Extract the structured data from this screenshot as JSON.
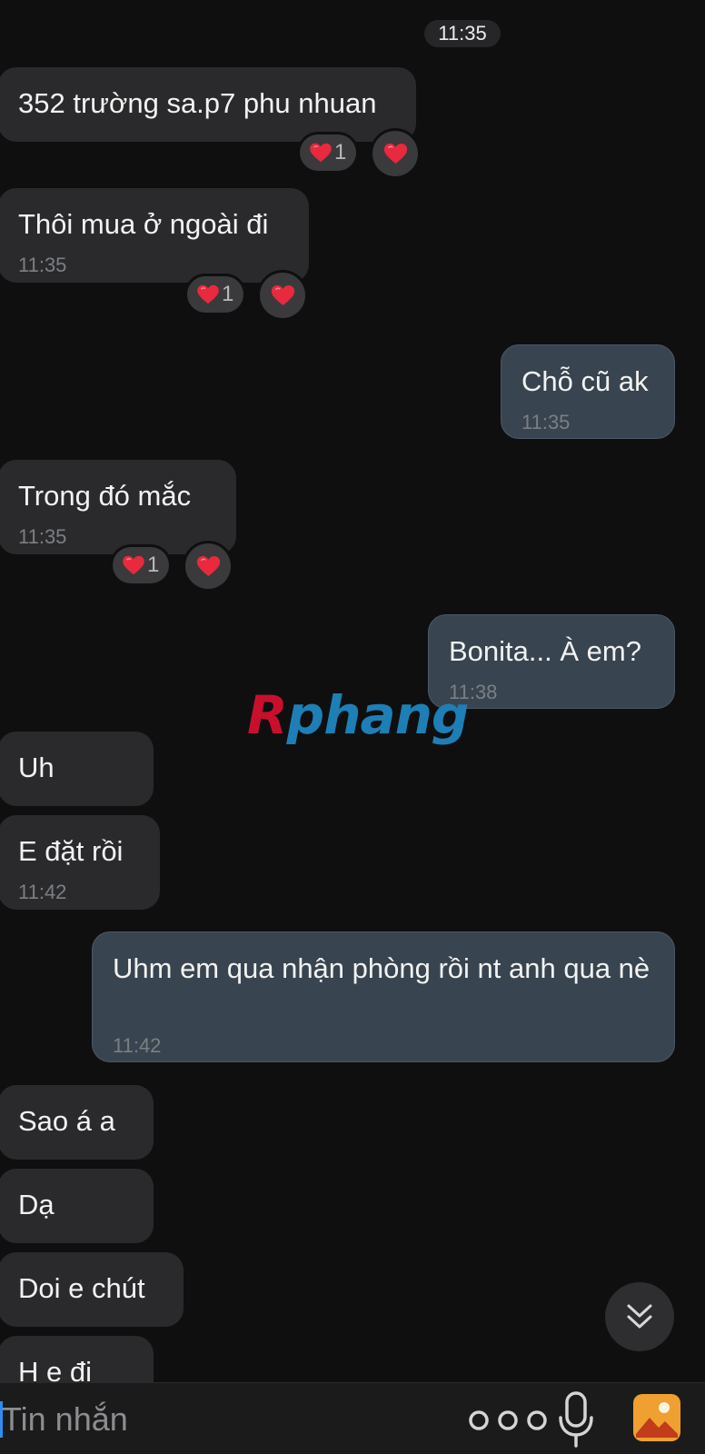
{
  "header": {
    "time": "11:35"
  },
  "messages": [
    {
      "dir": "in",
      "text": "352 trường sa.p7 phu nhuan",
      "time": "",
      "reaction": "❤️",
      "reaction_count": "1"
    },
    {
      "dir": "in",
      "text": "Thôi mua ở ngoài đi",
      "time": "11:35",
      "reaction": "❤️",
      "reaction_count": "1"
    },
    {
      "dir": "out",
      "text": "Chỗ cũ ak",
      "time": "11:35"
    },
    {
      "dir": "in",
      "text": "Trong đó mắc",
      "time": "11:35",
      "reaction": "❤️",
      "reaction_count": "1"
    },
    {
      "dir": "out",
      "text": "Bonita... À em?",
      "time": "11:38"
    },
    {
      "dir": "in",
      "text": "Uh",
      "time": ""
    },
    {
      "dir": "in",
      "text": "E đặt rồi",
      "time": "11:42"
    },
    {
      "dir": "out",
      "text": "Uhm em qua nhận phòng rồi nt anh qua nè",
      "time": "11:42"
    },
    {
      "dir": "in",
      "text": "Sao á a",
      "time": ""
    },
    {
      "dir": "in",
      "text": "Dạ",
      "time": ""
    },
    {
      "dir": "in",
      "text": "Doi e chút",
      "time": ""
    },
    {
      "dir": "in",
      "text": "H e đi",
      "time": ""
    }
  ],
  "watermark": {
    "first_letter": "R",
    "rest": "phang"
  },
  "composer": {
    "placeholder": "Tin nhắn",
    "more_icon": "more-dots-icon",
    "mic_icon": "microphone-icon",
    "gallery_icon": "gallery-icon"
  },
  "colors": {
    "background": "#0f0f10",
    "incoming_bubble": "#2a2a2c",
    "outgoing_bubble": "#38444f",
    "heart": "#e8293e",
    "watermark_red": "#c8102e",
    "watermark_blue": "#1d7fb5"
  }
}
